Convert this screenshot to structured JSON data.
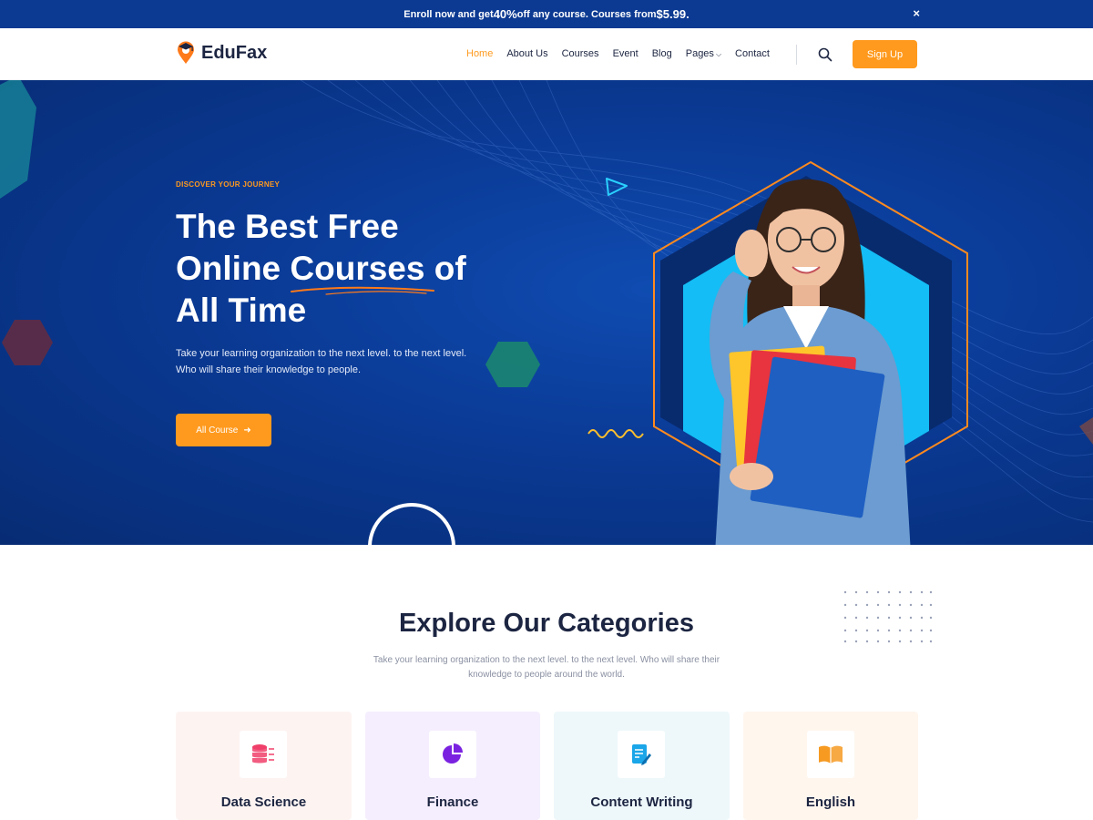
{
  "promo": {
    "prefix": "Enroll now and get ",
    "discount": "40%",
    "middle": " off any course. Courses from ",
    "price": "$5.99.",
    "close_label": "×"
  },
  "brand": {
    "name": "EduFax",
    "accent": "#ff9a1e",
    "primary": "#0c3a92"
  },
  "nav": {
    "items": [
      {
        "label": "Home",
        "active": true
      },
      {
        "label": "About Us"
      },
      {
        "label": "Courses"
      },
      {
        "label": "Event"
      },
      {
        "label": "Blog"
      },
      {
        "label": "Pages",
        "has_dropdown": true
      },
      {
        "label": "Contact"
      }
    ],
    "signup_label": "Sign Up",
    "search_icon": "search-icon"
  },
  "hero": {
    "eyebrow": "DISCOVER YOUR JOURNEY",
    "title_line1": "The Best Free",
    "title_line2_a": "Online ",
    "title_line2_b": "Courses",
    "title_line2_c": " of",
    "title_line3": "All Time",
    "description": "Take your learning organization to the next level. to the next level. Who will share their knowledge to people.",
    "cta_label": "All Course",
    "cta_icon": "arrow-right-icon"
  },
  "categories": {
    "title": "Explore Our Categories",
    "description": "Take your learning organization to the next level. to the next level. Who will share their knowledge to people around the world.",
    "items": [
      {
        "name": "Data Science",
        "icon": "database-icon",
        "bg": "#fdf4f2",
        "color": "#f0406a"
      },
      {
        "name": "Finance",
        "icon": "pie-chart-icon",
        "bg": "#f5eefe",
        "color": "#7a22e0"
      },
      {
        "name": "Content Writing",
        "icon": "document-edit-icon",
        "bg": "#eef8fb",
        "color": "#1aa6e8"
      },
      {
        "name": "English",
        "icon": "open-book-icon",
        "bg": "#fff6ee",
        "color": "#f69a22"
      }
    ]
  }
}
